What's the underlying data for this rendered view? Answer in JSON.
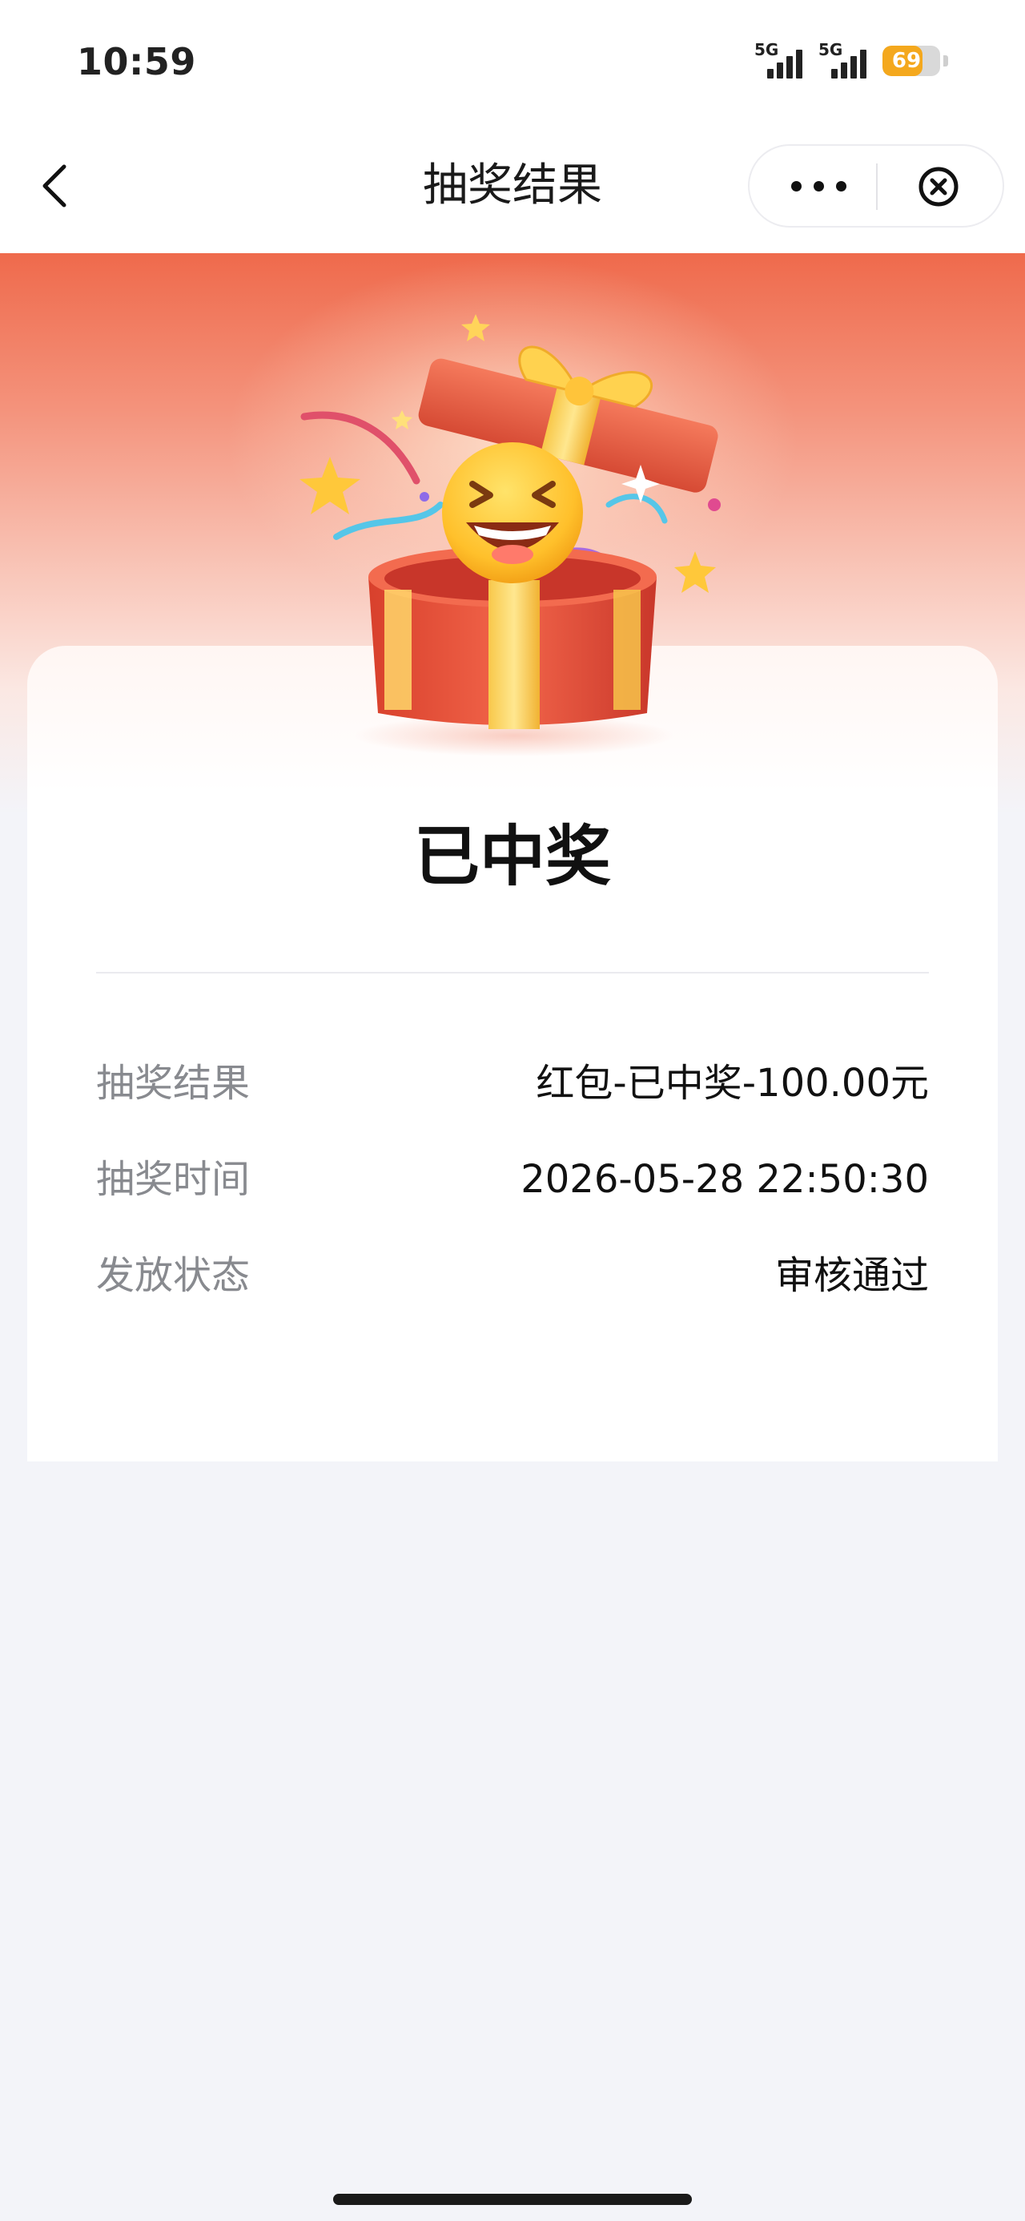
{
  "status_bar": {
    "time": "10:59",
    "signal_1_label": "5G",
    "signal_2_label": "5G",
    "battery_level": "69",
    "battery_fraction": 0.69
  },
  "nav": {
    "title": "抽奖结果",
    "back_icon": "chevron-left-icon",
    "more_icon": "more-horizontal-icon",
    "close_icon": "circle-close-icon"
  },
  "result": {
    "status_title": "已中奖",
    "rows": [
      {
        "label": "抽奖结果",
        "value": "红包-已中奖-100.00元"
      },
      {
        "label": "抽奖时间",
        "value": "2026-05-28 22:50:30"
      },
      {
        "label": "发放状态",
        "value": "审核通过"
      }
    ]
  },
  "colors": {
    "hero_top": "#ef6a4c",
    "page_bg": "#f3f4f9",
    "battery": "#f4a81d",
    "label_gray": "#888a8f"
  },
  "illustration": "gift-box-with-laughing-emoji"
}
